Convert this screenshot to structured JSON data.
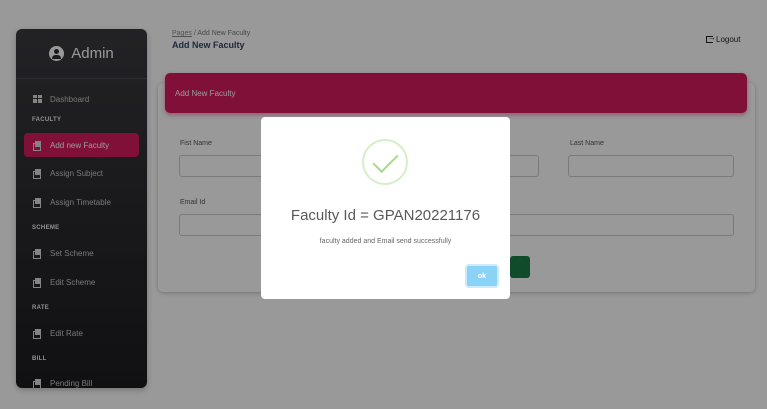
{
  "sidebar": {
    "brand": "Admin",
    "items": [
      {
        "label": "Dashboard",
        "icon": "dashboard-icon"
      },
      {
        "label": "Add new Faculty",
        "icon": "copy-icon",
        "active": true
      },
      {
        "label": "Assign Subject",
        "icon": "copy-icon"
      },
      {
        "label": "Assign Timetable",
        "icon": "copy-icon"
      },
      {
        "label": "Set Scheme",
        "icon": "copy-icon"
      },
      {
        "label": "Edit Scheme",
        "icon": "copy-icon"
      },
      {
        "label": "Edit Rate",
        "icon": "copy-icon"
      },
      {
        "label": "Pending Bill",
        "icon": "copy-icon"
      }
    ],
    "sections": [
      "FACULTY",
      "SCHEME",
      "RATE",
      "BILL"
    ]
  },
  "header": {
    "breadcrumb_link": "Pages",
    "breadcrumb_sep": "/",
    "breadcrumb_current": "Add New Faculty",
    "title": "Add New Faculty",
    "logout_label": "Logout"
  },
  "form": {
    "card_title": "Add New Faculty",
    "first_name_label": "Fist Name",
    "last_name_label": "Last Name",
    "email_label": "Email Id"
  },
  "modal": {
    "title": "Faculty Id = GPAN20221176",
    "message": "faculty added and Email send successfully",
    "ok_label": "ok"
  },
  "colors": {
    "accent": "#d81b60",
    "sidebar_bg": "#2c2c32",
    "success": "#a5dc86",
    "ok_button": "#8ad3f7",
    "submit_button": "#1b7d4a"
  }
}
